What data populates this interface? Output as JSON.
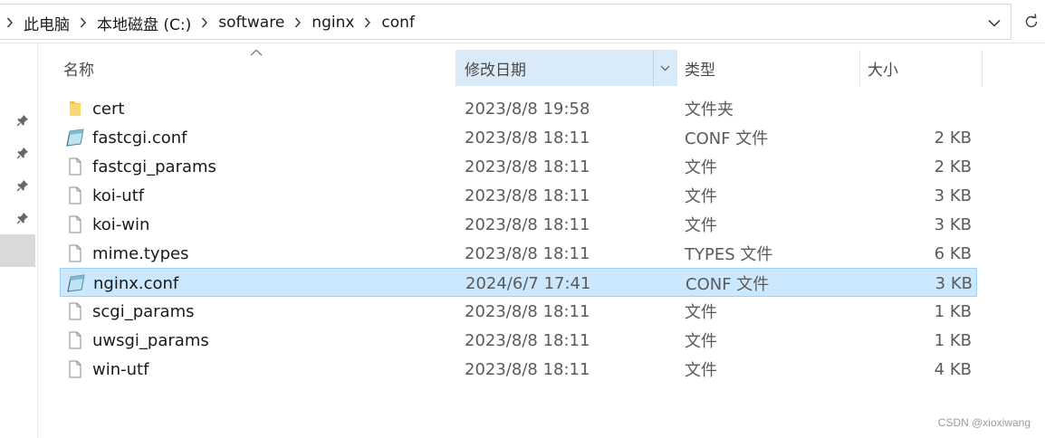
{
  "address_bar": {
    "breadcrumbs": [
      "此电脑",
      "本地磁盘 (C:)",
      "software",
      "nginx",
      "conf"
    ]
  },
  "columns": {
    "name": "名称",
    "date": "修改日期",
    "type": "类型",
    "size": "大小"
  },
  "files": [
    {
      "name": "cert",
      "date": "2023/8/8 19:58",
      "type": "文件夹",
      "size": "",
      "icon": "folder-icon",
      "selected": false
    },
    {
      "name": "fastcgi.conf",
      "date": "2023/8/8 18:11",
      "type": "CONF 文件",
      "size": "2 KB",
      "icon": "conf-file-icon",
      "selected": false
    },
    {
      "name": "fastcgi_params",
      "date": "2023/8/8 18:11",
      "type": "文件",
      "size": "2 KB",
      "icon": "file-icon",
      "selected": false
    },
    {
      "name": "koi-utf",
      "date": "2023/8/8 18:11",
      "type": "文件",
      "size": "3 KB",
      "icon": "file-icon",
      "selected": false
    },
    {
      "name": "koi-win",
      "date": "2023/8/8 18:11",
      "type": "文件",
      "size": "3 KB",
      "icon": "file-icon",
      "selected": false
    },
    {
      "name": "mime.types",
      "date": "2023/8/8 18:11",
      "type": "TYPES 文件",
      "size": "6 KB",
      "icon": "file-icon",
      "selected": false
    },
    {
      "name": "nginx.conf",
      "date": "2024/6/7 17:41",
      "type": "CONF 文件",
      "size": "3 KB",
      "icon": "conf-file-icon",
      "selected": true
    },
    {
      "name": "scgi_params",
      "date": "2023/8/8 18:11",
      "type": "文件",
      "size": "1 KB",
      "icon": "file-icon",
      "selected": false
    },
    {
      "name": "uwsgi_params",
      "date": "2023/8/8 18:11",
      "type": "文件",
      "size": "1 KB",
      "icon": "file-icon",
      "selected": false
    },
    {
      "name": "win-utf",
      "date": "2023/8/8 18:11",
      "type": "文件",
      "size": "4 KB",
      "icon": "file-icon",
      "selected": false
    }
  ],
  "watermark": "CSDN @xioxiwang",
  "colors": {
    "selection_bg": "#cce8ff",
    "selection_border": "#99d1ff",
    "sorted_header_bg": "#d9ebf9",
    "folder": "#f4c542"
  }
}
